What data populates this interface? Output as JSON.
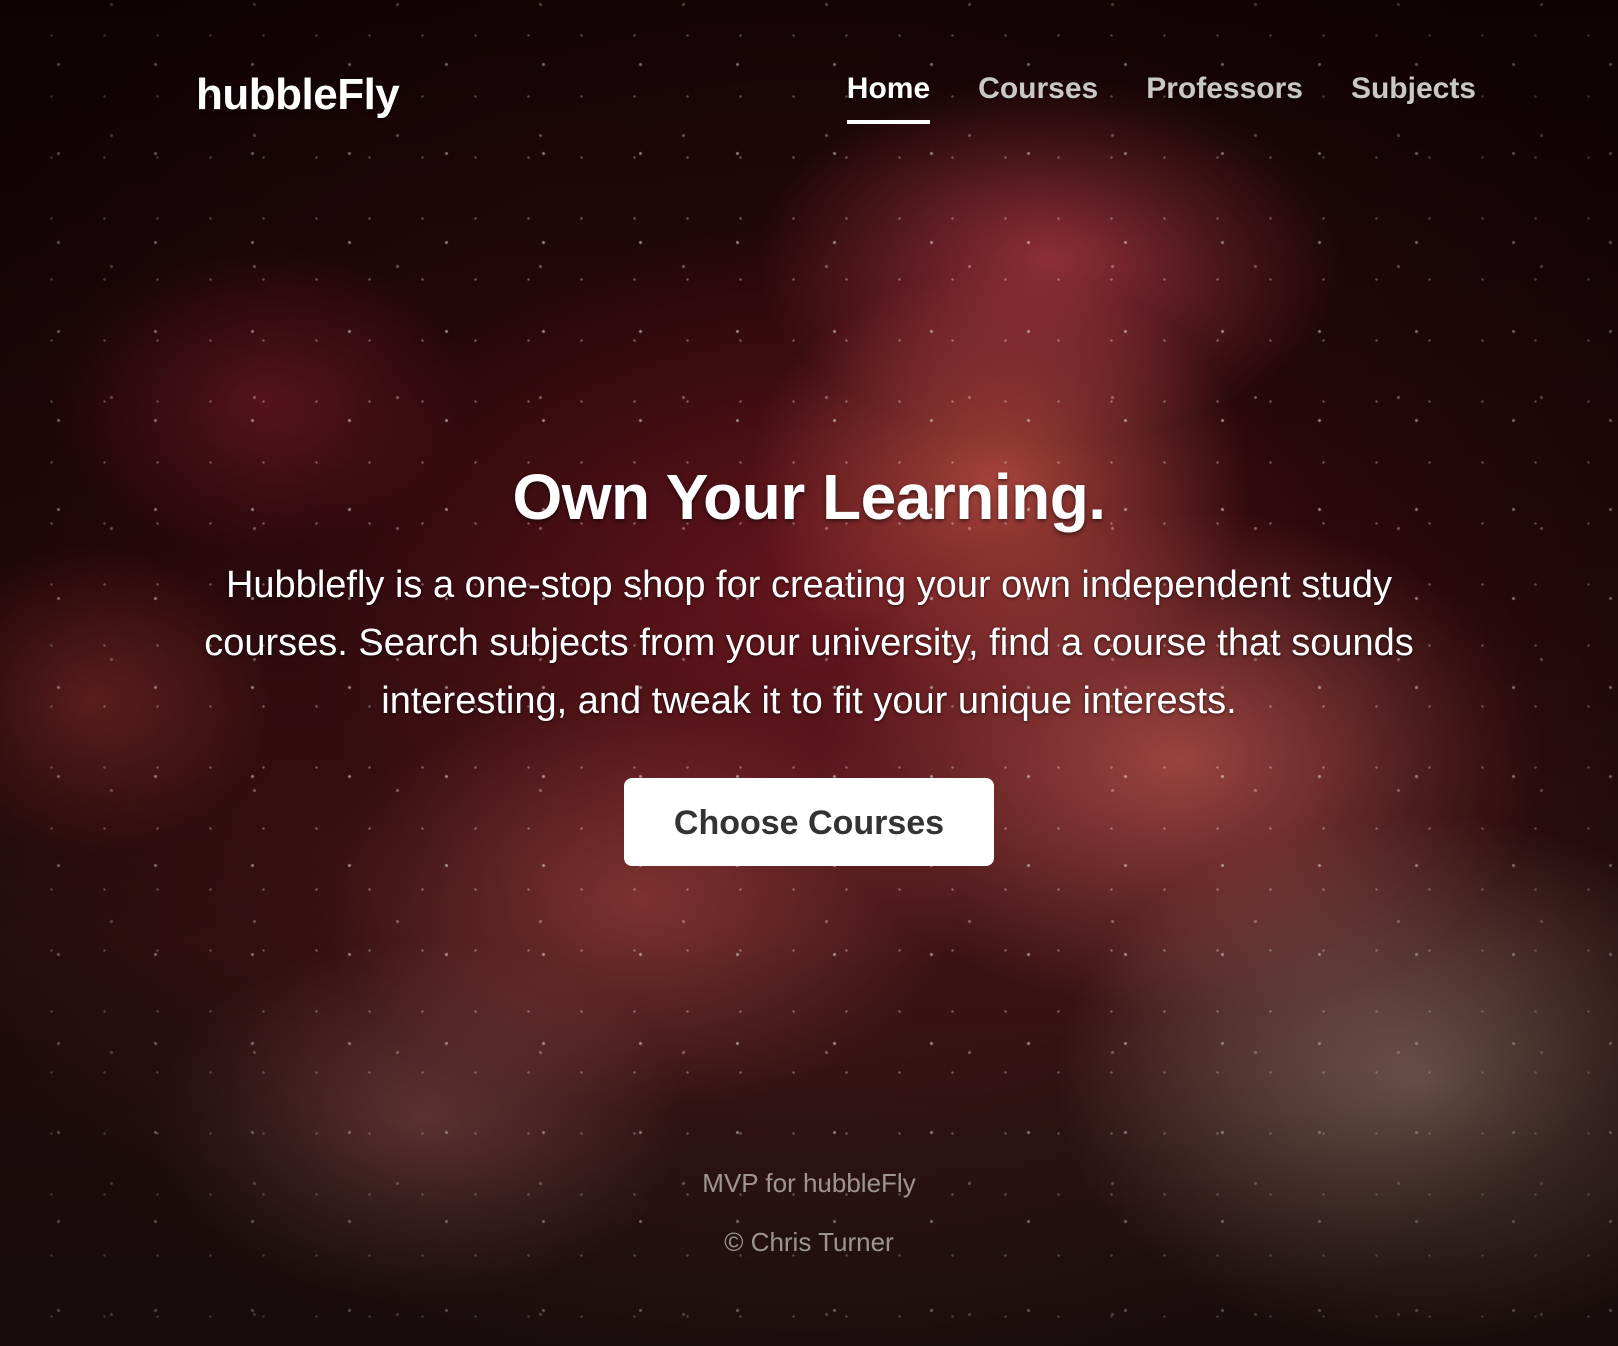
{
  "header": {
    "brand": "hubbleFly",
    "nav": [
      {
        "label": "Home",
        "active": true
      },
      {
        "label": "Courses",
        "active": false
      },
      {
        "label": "Professors",
        "active": false
      },
      {
        "label": "Subjects",
        "active": false
      }
    ]
  },
  "hero": {
    "title": "Own Your Learning.",
    "lead": "Hubblefly is a one-stop shop for creating your own independent study courses. Search subjects from your university, find a course that sounds interesting, and tweak it to fit your unique interests.",
    "cta_label": "Choose Courses"
  },
  "footer": {
    "line1_prefix": "MVP for ",
    "line1_link": "hubbleFly",
    "line2": "© Chris Turner"
  },
  "colors": {
    "cta_background": "#ffffff",
    "cta_text": "#333333",
    "text": "#ffffff",
    "footer_text": "rgba(255,255,255,0.55)"
  }
}
